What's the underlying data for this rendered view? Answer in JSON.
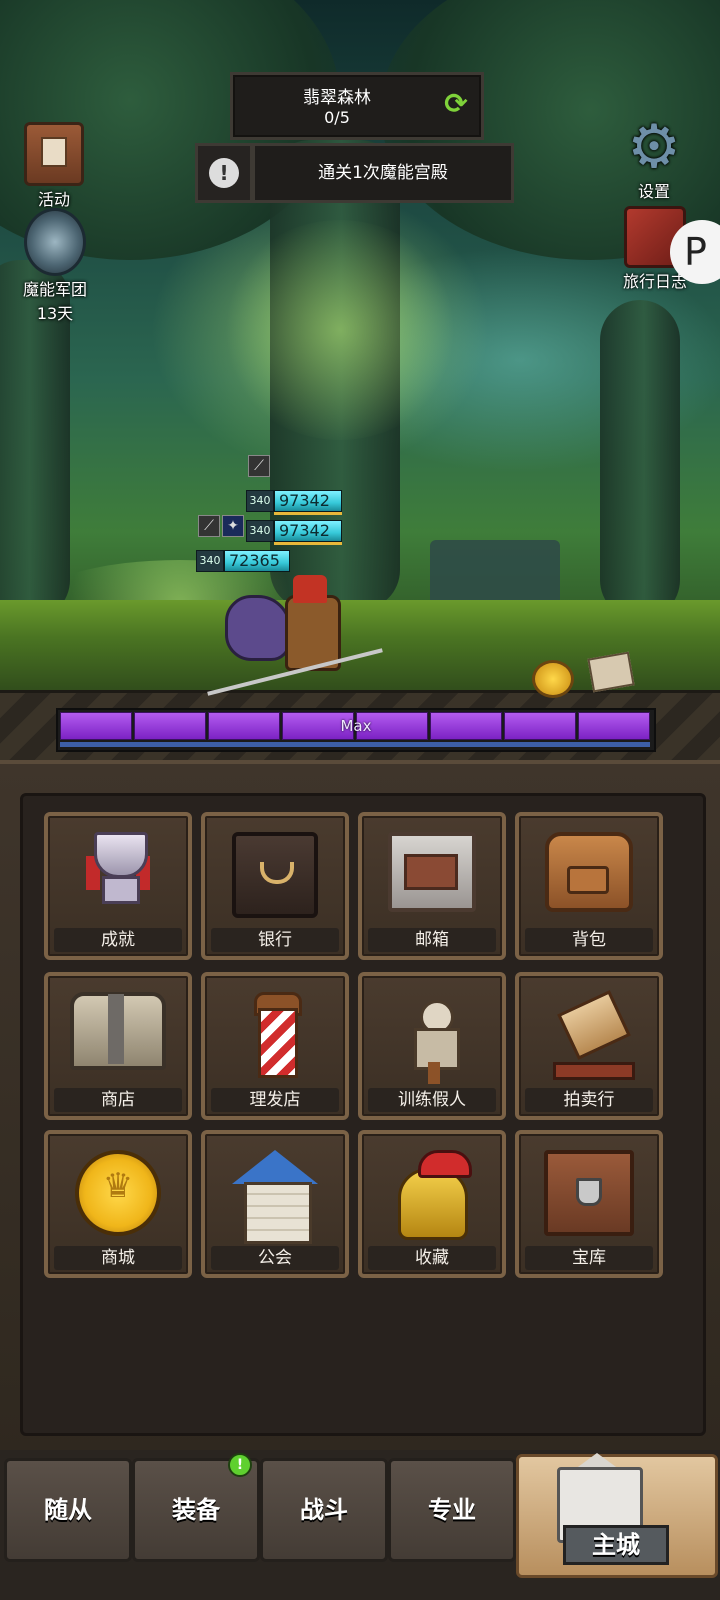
{
  "hud": {
    "zone_name": "翡翠森林",
    "zone_progress": "0/5",
    "quest_text": "通关1次魔能宫殿",
    "alert_symbol": "!",
    "refresh_symbol": "⟳"
  },
  "side_buttons": {
    "events_label": "活动",
    "legion_label": "魔能军团",
    "legion_timer": "13天",
    "settings_label": "设置",
    "travel_log_label": "旅行日志",
    "badge_letter": "P"
  },
  "combat": {
    "units": [
      {
        "level": "340",
        "hp": "97342"
      },
      {
        "level": "340",
        "hp": "97342"
      },
      {
        "level": "340",
        "hp": "72365"
      }
    ],
    "level_bar_label": "Max"
  },
  "grid": {
    "tiles": [
      {
        "label": "成就",
        "icon": "trophy-icon"
      },
      {
        "label": "银行",
        "icon": "safe-icon"
      },
      {
        "label": "邮箱",
        "icon": "mailbox-icon"
      },
      {
        "label": "背包",
        "icon": "backpack-icon"
      },
      {
        "label": "商店",
        "icon": "chest-icon"
      },
      {
        "label": "理发店",
        "icon": "barber-pole-icon"
      },
      {
        "label": "训练假人",
        "icon": "training-dummy-icon"
      },
      {
        "label": "拍卖行",
        "icon": "gavel-icon"
      },
      {
        "label": "商城",
        "icon": "gold-coin-icon"
      },
      {
        "label": "公会",
        "icon": "guild-house-icon"
      },
      {
        "label": "收藏",
        "icon": "helmet-icon"
      },
      {
        "label": "宝库",
        "icon": "vault-icon"
      }
    ]
  },
  "bottom_nav": {
    "tabs": [
      {
        "label": "随从"
      },
      {
        "label": "装备"
      },
      {
        "label": "战斗"
      },
      {
        "label": "专业"
      },
      {
        "label": "主城"
      }
    ],
    "active_tab": "主城",
    "notification_symbol": "!"
  },
  "colors": {
    "accent_green": "#7fd23a",
    "hp_cyan": "#36c8d8",
    "level_purple": "#7c22c4",
    "tile_border": "#7b6246"
  }
}
